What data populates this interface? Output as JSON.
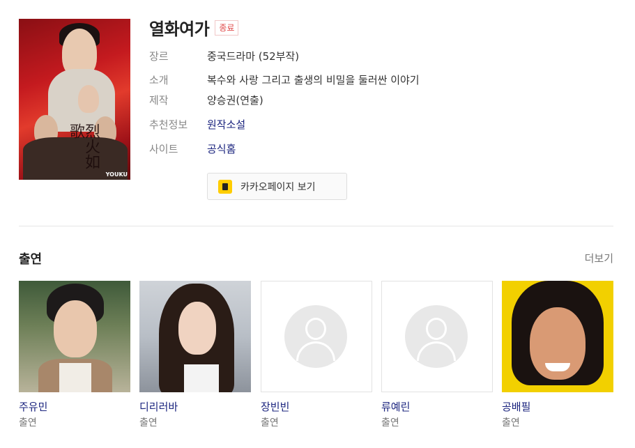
{
  "drama": {
    "title": "열화여가",
    "status": "종료",
    "poster_text": "烈火如歌",
    "poster_brand": "YOUKU"
  },
  "info": [
    {
      "label": "장르",
      "value": "중국드라마 (52부작)",
      "link": false
    },
    {
      "label": "소개",
      "value": "복수와 사랑 그리고 출생의 비밀을 둘러싼 이야기",
      "link": false
    },
    {
      "label": "제작",
      "value": "양승권(연출)",
      "link": false
    },
    {
      "label": "추천정보",
      "value": "원작소설",
      "link": true
    },
    {
      "label": "사이트",
      "value": "공식홈",
      "link": true
    }
  ],
  "kakao_button": {
    "label": "카카오페이지 보기",
    "icon": "kakaopage-icon",
    "color": "#ffcd00"
  },
  "cast_section": {
    "title": "출연",
    "more_label": "더보기",
    "members": [
      {
        "name": "주유민",
        "role": "출연"
      },
      {
        "name": "디리러바",
        "role": "출연"
      },
      {
        "name": "장빈빈",
        "role": "출연"
      },
      {
        "name": "류예린",
        "role": "출연"
      },
      {
        "name": "공배필",
        "role": "출연"
      }
    ]
  },
  "colors": {
    "link": "#1a237e",
    "status": "#e04a4a",
    "label": "#888888"
  }
}
